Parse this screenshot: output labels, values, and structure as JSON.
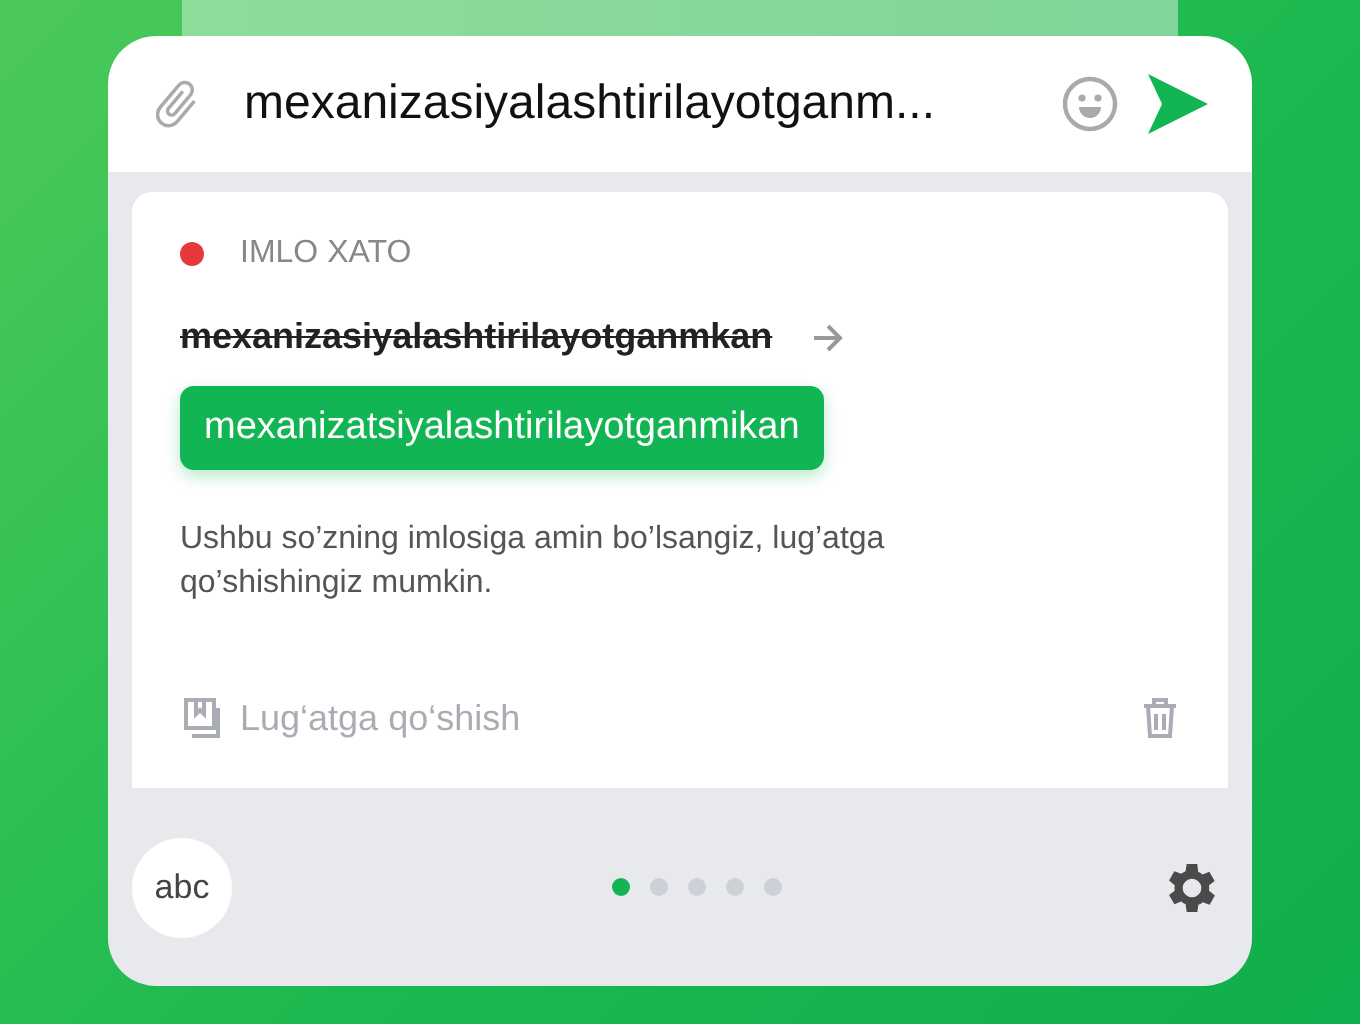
{
  "composer": {
    "value": "mexanizasiyalashtirilayotganm..."
  },
  "suggestion": {
    "category": "IMLO XATO",
    "color": "#e8383d",
    "wrong_word": "mexanizasiyalashtirilayotganmkan",
    "correction": "mexanizatsiyalashtirilayotganmikan",
    "message": "Ushbu so’zning imlosiga amin bo’lsangiz, lug’atga qo’shishingiz mumkin.",
    "add_to_dictionary": "Lug‘atga qo‘shish"
  },
  "keyboard_button": "abc",
  "pages": [
    {
      "selected": true
    },
    {
      "selected": false
    },
    {
      "selected": false
    },
    {
      "selected": false
    },
    {
      "selected": false
    }
  ]
}
